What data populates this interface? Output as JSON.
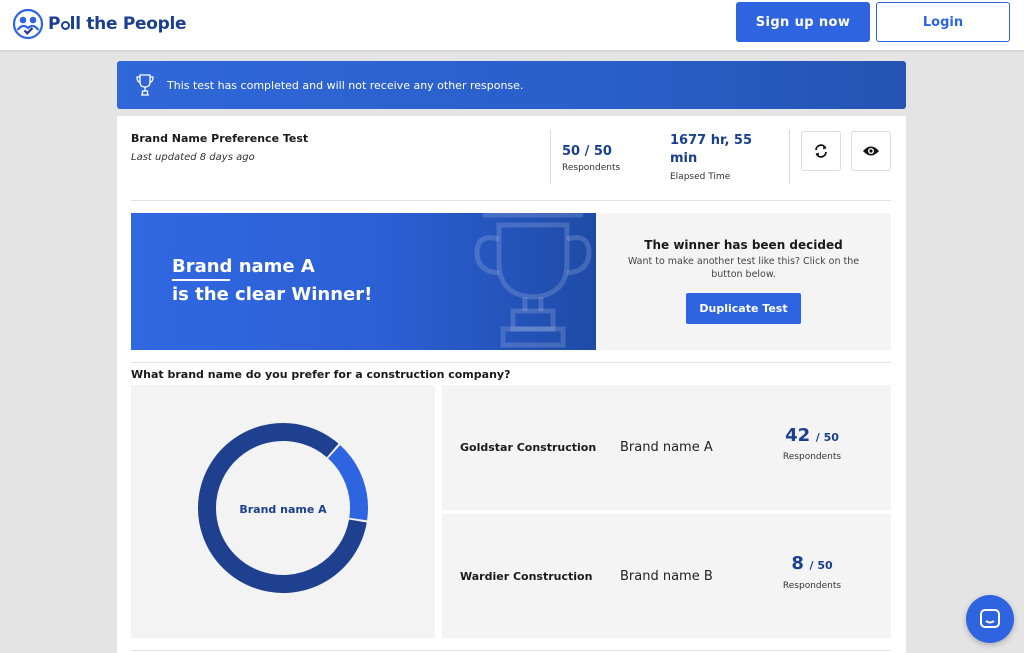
{
  "header": {
    "brand_prefix": "P",
    "brand_rest": "ll the People",
    "signup_label": "Sign up now",
    "login_label": "Login"
  },
  "banner": {
    "message": "This test has completed and will not receive any other response."
  },
  "test": {
    "title": "Brand Name Preference Test",
    "updated": "Last updated 8 days ago",
    "respondents_value": "50 / 50",
    "respondents_label": "Respondents",
    "elapsed_value_line1": "1677 hr, 55",
    "elapsed_value_line2": "min",
    "elapsed_label": "Elapsed Time"
  },
  "winner": {
    "line1": "Brand name A",
    "line2": "is the clear Winner!",
    "decided_title": "The winner has been decided",
    "decided_sub": "Want to make another test like this? Click on the button below.",
    "duplicate_label": "Duplicate Test"
  },
  "question": "What brand name do you prefer for a construction company?",
  "chart_data": {
    "type": "pie",
    "center_label": "Brand name A",
    "categories": [
      "Brand name A",
      "Brand name B"
    ],
    "values": [
      42,
      8
    ],
    "colors": [
      "#1f3f8f",
      "#2f64e0"
    ]
  },
  "results": [
    {
      "option": "Goldstar Construction",
      "brand": "Brand name A",
      "count": "42",
      "total": "/ 50",
      "label": "Respondents"
    },
    {
      "option": "Wardier Construction",
      "brand": "Brand name B",
      "count": "8",
      "total": "/ 50",
      "label": "Respondents"
    }
  ],
  "icons": {
    "logo": "people-check-logo-icon",
    "banner": "trophy-icon",
    "refresh": "refresh-icon",
    "view": "eye-icon",
    "chat": "chat-icon"
  },
  "colors": {
    "primary": "#2f64e0",
    "navy": "#1a3f8f"
  }
}
